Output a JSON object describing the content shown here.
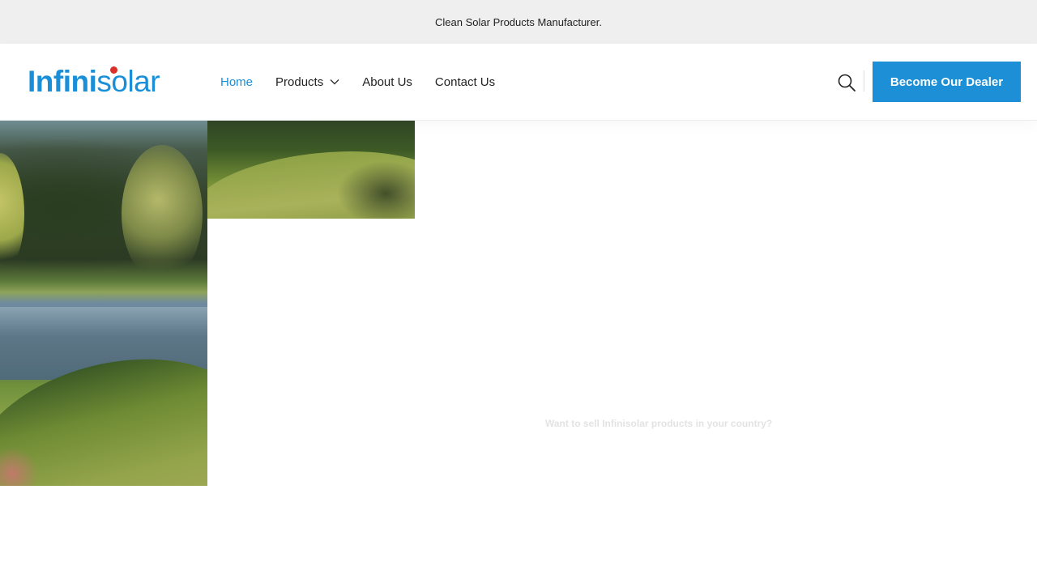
{
  "topbar": {
    "text": "Clean Solar Products Manufacturer."
  },
  "logo": {
    "part1": "Infini",
    "part2": "solar"
  },
  "nav": {
    "home": "Home",
    "products": "Products",
    "about": "About Us",
    "contact": "Contact Us"
  },
  "cta": {
    "label": "Become Our Dealer"
  },
  "hero": {
    "faint_text": "Want to sell Infinisolar products in your country?"
  },
  "colors": {
    "brand": "#1a8fd8",
    "cta": "#1d8fd6",
    "logo_dot": "#d9302a",
    "topbar_bg": "#efefef"
  },
  "icons": {
    "search": "search-icon",
    "chevron": "chevron-down-icon"
  }
}
